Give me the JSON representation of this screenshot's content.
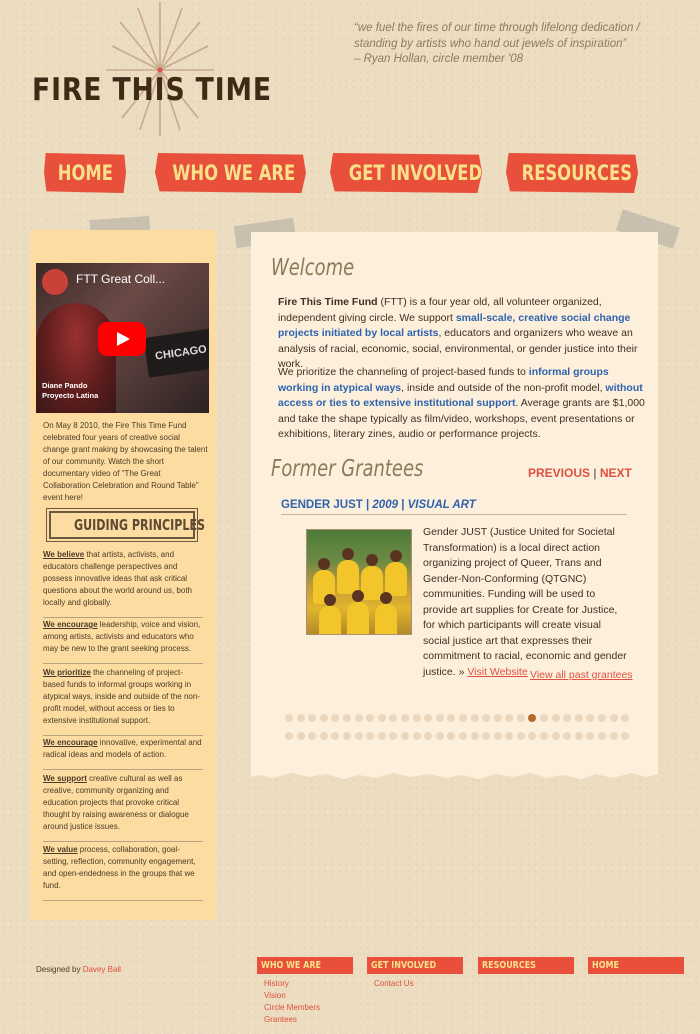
{
  "brand": {
    "logo_text": "FIRE THIS TIME",
    "quote": "“we fuel the fires of our time through lifelong dedication / standing by artists who hand out jewels of inspiration”",
    "quote_author": "– Ryan Hollan, circle member '08"
  },
  "nav": {
    "items": [
      "HOME",
      "WHO WE ARE",
      "GET INVOLVED",
      "RESOURCES"
    ]
  },
  "sidebar": {
    "video": {
      "title": "FTT Great Coll...",
      "sign_text": "CHICAGO",
      "caption_line1": "Diane Pando",
      "caption_line2": "Proyecto Latina"
    },
    "intro": "On May 8 2010, the Fire This Time Fund celebrated four years of creative social change grant making by showcasing the talent of our community. Watch the short documentary video of \"The Great Collaboration Celebration and Round Table\" event here!",
    "guiding_title": "GUIDING PRINCIPLES",
    "principles": [
      {
        "lead": "We believe",
        "text": " that artists, activists, and educators challenge perspectives and possess innovative ideas that ask critical questions about the world around us, both locally and globally."
      },
      {
        "lead": "We encourage",
        "text": " leadership, voice and vision, among artists, activists and educators who may be new to the grant seeking process."
      },
      {
        "lead": "We prioritize",
        "text": " the channeling of project-based funds to informal groups working in atypical ways, inside and outside of the non-profit model, without access or ties to extensive institutional support."
      },
      {
        "lead": "We encourage",
        "text": " innovative, experimental and radical ideas and models of action."
      },
      {
        "lead": "We support",
        "text": " creative cultural as well as creative, community organizing and education projects that provoke critical thought by raising awareness or dialogue around justice issues."
      },
      {
        "lead": "We value",
        "text": " process, collaboration, goal-setting, reflection, community engagement, and open-endedness in the groups that we fund."
      }
    ]
  },
  "main": {
    "welcome_heading": "Welcome",
    "para1": {
      "bold_lead": "Fire This Time Fund",
      "t1": " (FTT) is a four year old, all volunteer organized, independent giving circle. We support ",
      "blue1": "small-scale, creative social change projects initiated by local artists",
      "t2": ", educators and organizers who weave an analysis of racial, economic, social, environmental, or gender justice into their work."
    },
    "para2": {
      "t1": "We prioritize the channeling of project-based funds to ",
      "blue1": "informal groups working in atypical ways",
      "t2": ", inside and outside of the non-profit model, ",
      "blue2": "without access or ties to extensive institutional support",
      "t3": ". Average grants are $1,000 and take the shape typically as film/video, workshops, event presentations or exhibitions, literary zines, audio or performance projects."
    },
    "grantees_heading": "Former Grantees",
    "pager": {
      "prev": "PREVIOUS",
      "sep": " | ",
      "next": "NEXT"
    },
    "grantee": {
      "name": "GENDER JUST",
      "sep1": " | ",
      "year": "2009",
      "sep2": " | ",
      "category": "VISUAL ART",
      "description": "Gender JUST (Justice United for Societal Transformation) is a local direct action organizing project of Queer, Trans and Gender-Non-Conforming (QTGNC) communities. Funding will be used to provide art supplies for Create for Justice, for which participants will create visual social justice art that expresses their commitment to racial, economic and gender justice. » ",
      "website_link": "Visit Website"
    },
    "view_all": "View all past grantees",
    "pagination_dots": {
      "total": 60,
      "active_index": 21
    }
  },
  "footer": {
    "credit_prefix": "Designed by ",
    "credit_name": "Davey Ball",
    "columns": [
      {
        "heading": "WHO WE ARE",
        "links": [
          "History",
          "Vision",
          "Circle Members",
          "Grantees"
        ]
      },
      {
        "heading": "GET INVOLVED",
        "links": [
          "Contact Us"
        ]
      },
      {
        "heading": "RESOURCES",
        "links": []
      },
      {
        "heading": "HOME",
        "links": []
      }
    ]
  },
  "colors": {
    "background": "#ecdcc0",
    "nav_red": "#e8503c",
    "nav_text_yellow": "#f7e28a",
    "link_blue": "#2f63ad",
    "link_red": "#e05040",
    "sidebar_bg": "#fcdca0",
    "panel_bg": "#fcf0dc"
  }
}
